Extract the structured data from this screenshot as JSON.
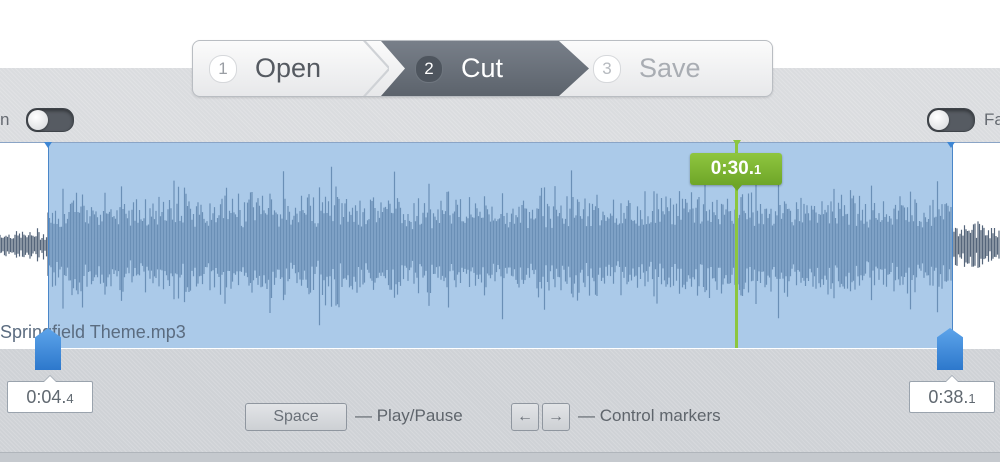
{
  "steps": [
    {
      "number": "1",
      "label": "Open"
    },
    {
      "number": "2",
      "label": "Cut"
    },
    {
      "number": "3",
      "label": "Save"
    }
  ],
  "toggles": {
    "left_label": "n",
    "right_label": "Fa"
  },
  "waveform": {
    "file_name": "Springfield Theme.mp3",
    "selection_color": "#78aadc",
    "wave_color": "#55657a"
  },
  "playhead": {
    "time_main": "0:30.",
    "time_fraction": "1",
    "color": "#8cc63f"
  },
  "markers": {
    "start_main": "0:04.",
    "start_fraction": "4",
    "end_main": "0:38.",
    "end_fraction": "1"
  },
  "hints": {
    "space_key": "Space",
    "play_pause": "— Play/Pause",
    "left_arrow": "←",
    "right_arrow": "→",
    "control_markers": "— Control markers"
  }
}
